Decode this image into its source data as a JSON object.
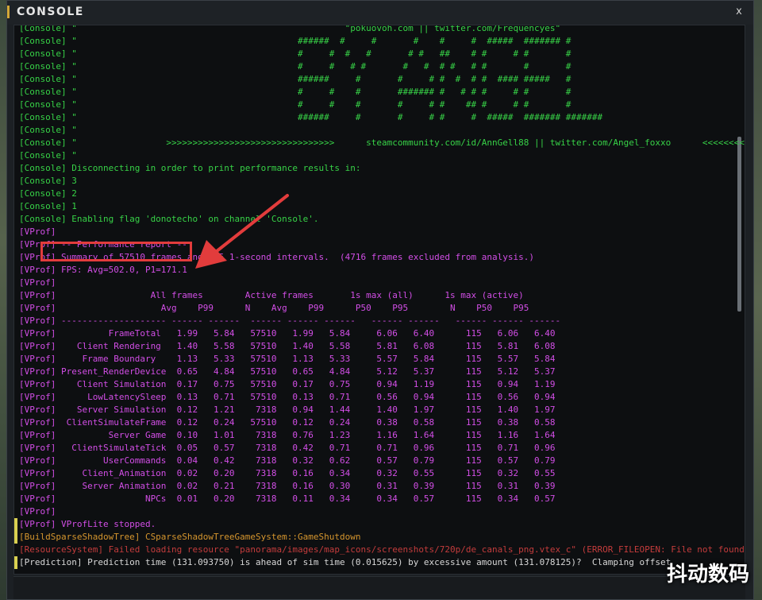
{
  "window": {
    "title": "CONSOLE",
    "close_label": "x"
  },
  "watermark": "抖动数码",
  "colors": {
    "green": "#37d247",
    "magenta": "#d24ee6",
    "orange": "#d6962e",
    "red": "#c43c3c",
    "white": "#d8d8d8",
    "annotation": "#e23c3c"
  },
  "lines": [
    {
      "c": "green",
      "t": "[Console] \"                                                   \"pokuovoh.com || twitter.com/Frequencyes\""
    },
    {
      "c": "green",
      "t": "[Console] \"                                          ######  #     #       #    #     #  #####  ####### #"
    },
    {
      "c": "green",
      "t": "[Console] \"                                          #     #  #   #       # #   ##    # #     # #       #"
    },
    {
      "c": "green",
      "t": "[Console] \"                                          #     #   # #       #   #  # #   # #       #       #"
    },
    {
      "c": "green",
      "t": "[Console] \"                                          ######     #       #     # #  #  # #  #### #####   #"
    },
    {
      "c": "green",
      "t": "[Console] \"                                          #     #    #       ####### #   # # #     # #       #"
    },
    {
      "c": "green",
      "t": "[Console] \"                                          #     #    #       #     # #    ## #     # #       #"
    },
    {
      "c": "green",
      "t": "[Console] \"                                          ######     #       #     # #     #  #####  ####### #######"
    },
    {
      "c": "green",
      "t": "[Console] \""
    },
    {
      "c": "green",
      "t": "[Console] \"                 >>>>>>>>>>>>>>>>>>>>>>>>>>>>>>>>      steamcommunity.com/id/AnnGell88 || twitter.com/Angel_foxxo      <<<<<<<<<<"
    },
    {
      "c": "green",
      "t": "[Console] \""
    },
    {
      "c": "green",
      "t": "[Console] Disconnecting in order to print performance results in:"
    },
    {
      "c": "green",
      "t": "[Console] 3"
    },
    {
      "c": "green",
      "t": "[Console] 2"
    },
    {
      "c": "green",
      "t": "[Console] 1"
    },
    {
      "c": "green",
      "t": "[Console] Enabling flag 'donotecho' on channel 'Console'."
    },
    {
      "c": "magenta",
      "t": "[VProf]"
    },
    {
      "c": "magenta",
      "t": "[VProf] -- Performance report --"
    },
    {
      "c": "magenta",
      "t": "[VProf] Summary of 57510 frames and 115 1-second intervals.  (4716 frames excluded from analysis.)"
    },
    {
      "c": "magenta",
      "t": "[VProf] FPS: Avg=502.0, P1=171.1"
    },
    {
      "c": "magenta",
      "t": "[VProf]"
    },
    {
      "c": "magenta",
      "t": "[VProf]                  All frames        Active frames       1s max (all)      1s max (active)"
    },
    {
      "c": "magenta",
      "t": "[VProf]                    Avg    P99      N    Avg    P99      P50    P95        N    P50    P95"
    },
    {
      "c": "magenta",
      "t": "[VProf] -------------------- ------ ------  ------ ------ ------   ------ ------   ------ ------ ------"
    },
    {
      "c": "magenta",
      "t": "[VProf]          FrameTotal   1.99   5.84   57510   1.99   5.84     6.06   6.40      115   6.06   6.40"
    },
    {
      "c": "magenta",
      "t": "[VProf]    Client Rendering   1.40   5.58   57510   1.40   5.58     5.81   6.08      115   5.81   6.08"
    },
    {
      "c": "magenta",
      "t": "[VProf]     Frame Boundary    1.13   5.33   57510   1.13   5.33     5.57   5.84      115   5.57   5.84"
    },
    {
      "c": "magenta",
      "t": "[VProf] Present_RenderDevice  0.65   4.84   57510   0.65   4.84     5.12   5.37      115   5.12   5.37"
    },
    {
      "c": "magenta",
      "t": "[VProf]    Client Simulation  0.17   0.75   57510   0.17   0.75     0.94   1.19      115   0.94   1.19"
    },
    {
      "c": "magenta",
      "t": "[VProf]      LowLatencySleep  0.13   0.71   57510   0.13   0.71     0.56   0.94      115   0.56   0.94"
    },
    {
      "c": "magenta",
      "t": "[VProf]    Server Simulation  0.12   1.21    7318   0.94   1.44     1.40   1.97      115   1.40   1.97"
    },
    {
      "c": "magenta",
      "t": "[VProf]  ClientSimulateFrame  0.12   0.24   57510   0.12   0.24     0.38   0.58      115   0.38   0.58"
    },
    {
      "c": "magenta",
      "t": "[VProf]          Server Game  0.10   1.01    7318   0.76   1.23     1.16   1.64      115   1.16   1.64"
    },
    {
      "c": "magenta",
      "t": "[VProf]   ClientSimulateTick  0.05   0.57    7318   0.42   0.71     0.71   0.96      115   0.71   0.96"
    },
    {
      "c": "magenta",
      "t": "[VProf]         UserCommands  0.04   0.42    7318   0.32   0.62     0.57   0.79      115   0.57   0.79"
    },
    {
      "c": "magenta",
      "t": "[VProf]     Client_Animation  0.02   0.20    7318   0.16   0.34     0.32   0.55      115   0.32   0.55"
    },
    {
      "c": "magenta",
      "t": "[VProf]     Server Animation  0.02   0.21    7318   0.16   0.30     0.31   0.39      115   0.31   0.39"
    },
    {
      "c": "magenta",
      "t": "[VProf]                 NPCs  0.01   0.20    7318   0.11   0.34     0.34   0.57      115   0.34   0.57"
    },
    {
      "c": "magenta",
      "t": "[VProf]"
    },
    {
      "c": "magenta",
      "t": "[VProf] VProfLite stopped.",
      "bar": true
    },
    {
      "c": "orange",
      "t": "[BuildSparseShadowTree] CSparseShadowTreeGameSystem::GameShutdown",
      "bar": true
    },
    {
      "c": "red",
      "t": "[ResourceSystem] Failed loading resource \"panorama/images/map_icons/screenshots/720p/de_canals_png.vtex_c\" (ERROR_FILEOPEN: File not found)"
    },
    {
      "c": "white",
      "t": "[Prediction] Prediction time (131.093750) is ahead of sim time (0.015625) by excessive amount (131.078125)?  Clamping offset",
      "bar": true
    }
  ]
}
